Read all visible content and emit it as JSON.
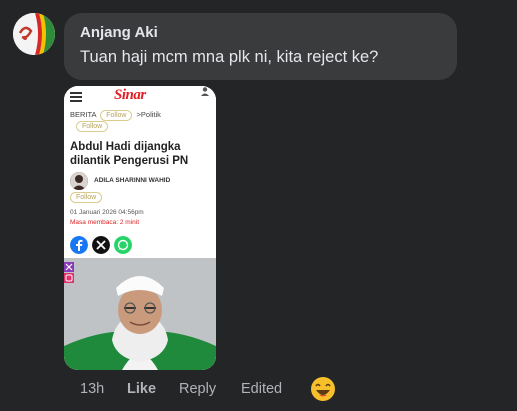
{
  "comment": {
    "author": "Anjang Aki",
    "text": "Tuan haji mcm mna plk ni, kita reject ke?",
    "avatar_icon": "avatar-icon",
    "timestamp": "13h",
    "like_label": "Like",
    "reply_label": "Reply",
    "edited_label": "Edited",
    "reaction_icon": "laughing-emoji-icon"
  },
  "attachment": {
    "site_logo": "Sinar",
    "breadcrumb_prefix": "BERITA",
    "follow_label": "Follow",
    "breadcrumb_section": ">Politik",
    "headline": "Abdul Hadi dijangka dilantik Pengerusi PN",
    "author_name": "ADILA SHARINNI WAHID",
    "date": "01 Januari 2026 04:56pm",
    "read_time": "Masa membaca: 2 minit"
  },
  "colors": {
    "background": "#242526",
    "bubble": "#3a3b3c",
    "text_primary": "#e4e6eb",
    "text_secondary": "#b0b3b8",
    "brand_red": "#e41e26"
  }
}
